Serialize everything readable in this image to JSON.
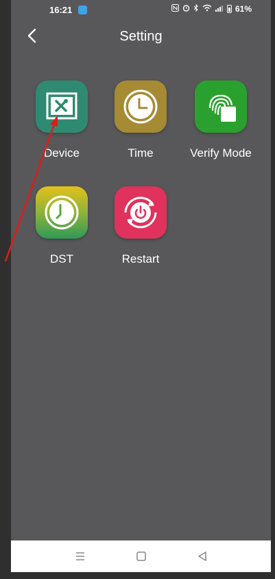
{
  "status_bar": {
    "time": "16:21",
    "battery": "61%"
  },
  "header": {
    "title": "Setting"
  },
  "tiles": [
    {
      "label": "Device",
      "icon": "device-tools-icon",
      "color": "#2f8a72"
    },
    {
      "label": "Time",
      "icon": "clock-icon",
      "color": "#a68a34"
    },
    {
      "label": "Verify Mode",
      "icon": "fingerprint-card-icon",
      "color": "#2aa12e"
    },
    {
      "label": "DST",
      "icon": "dst-clock-icon",
      "color_top": "#e3c11a",
      "color_bottom": "#2f9a57"
    },
    {
      "label": "Restart",
      "icon": "restart-power-icon",
      "color": "#e0325c"
    }
  ],
  "annotation": {
    "arrow_color": "#e01b1b"
  }
}
